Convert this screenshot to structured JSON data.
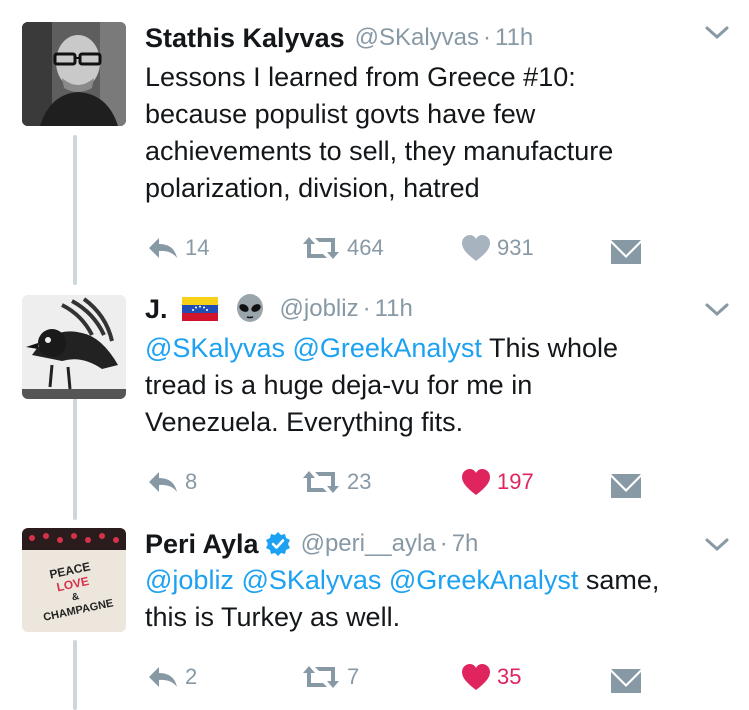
{
  "tweets": [
    {
      "name": "Stathis Kalyvas",
      "handle": "@SKalyvas",
      "time": "11h",
      "verified": false,
      "avatar": "avatar-photo-man-glasses",
      "text_plain": "Lessons I learned from Greece #10: because populist govts have few achievements to sell, they manufacture polarization, division, hatred",
      "lines": [
        "Lessons I learned from Greece #10:",
        "because populist govts have few",
        "achievements to sell, they manufacture",
        "polarization, division, hatred"
      ],
      "replies": "14",
      "retweets": "464",
      "likes": "931",
      "liked": false
    },
    {
      "name": "J.",
      "handle": "@jobliz",
      "time": "11h",
      "verified": false,
      "avatar": "avatar-bird-drawing",
      "name_emojis": [
        "venezuela-flag-icon",
        "alien-icon"
      ],
      "mentions": "@SKalyvas @GreekAnalyst",
      "line1_rest": " This whole",
      "line2": "tread is a huge deja-vu for me in",
      "line3": "Venezuela. Everything fits.",
      "replies": "8",
      "retweets": "23",
      "likes": "197",
      "liked": true
    },
    {
      "name": "Peri Ayla",
      "handle": "@peri__ayla",
      "time": "7h",
      "verified": true,
      "avatar": "avatar-peace-love-champagne",
      "avatar_text": [
        "PEACE",
        "LOVE",
        "&",
        "CHAMPAGNE"
      ],
      "mentions": "@jobliz @SKalyvas @GreekAnalyst",
      "line1_rest": " same,",
      "line2": "this is Turkey as well.",
      "replies": "2",
      "retweets": "7",
      "likes": "35",
      "liked": true
    }
  ],
  "colors": {
    "text": "#14171a",
    "muted": "#8899a6",
    "link": "#1da1f2",
    "like": "#e0245e",
    "thread_line": "#ccd6dd"
  },
  "dot": "·"
}
